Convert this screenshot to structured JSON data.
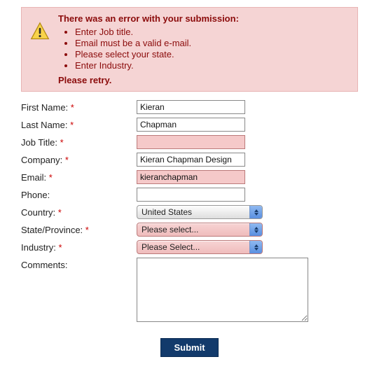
{
  "error": {
    "heading": "There was an error with your submission:",
    "items": [
      "Enter Job title.",
      "Email must be a valid e-mail.",
      "Please select your state.",
      "Enter Industry."
    ],
    "retry": "Please retry."
  },
  "labels": {
    "first_name": "First Name:",
    "last_name": "Last Name:",
    "job_title": "Job Title:",
    "company": "Company:",
    "email": "Email:",
    "phone": "Phone:",
    "country": "Country:",
    "state": "State/Province:",
    "industry": "Industry:",
    "comments": "Comments:",
    "asterisk": "*"
  },
  "values": {
    "first_name": "Kieran",
    "last_name": "Chapman",
    "job_title": "",
    "company": "Kieran Chapman Design",
    "email": "kieranchapman",
    "phone": "",
    "country": "United States",
    "state": "Please select...",
    "industry": "Please Select...",
    "comments": ""
  },
  "buttons": {
    "submit": "Submit"
  }
}
